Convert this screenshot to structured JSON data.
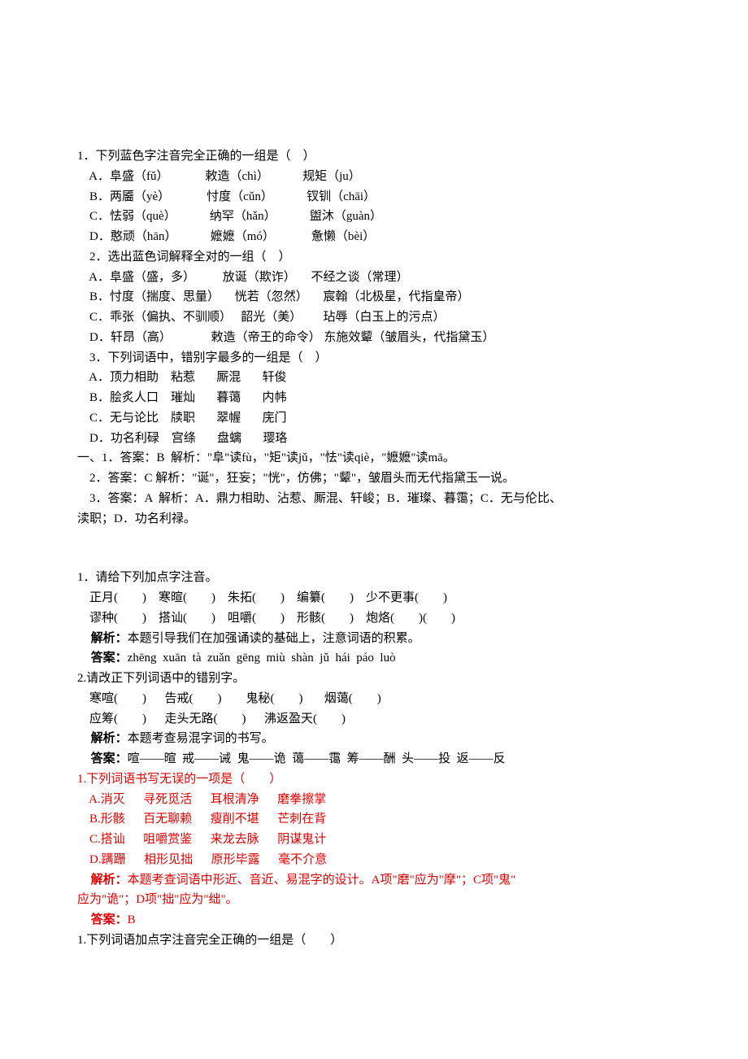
{
  "block1": {
    "q1": {
      "stem": "1．下列蓝色字注音完全正确的一组是（　）",
      "A": "    A．阜盛（fǔ）            敕造（chì）           规矩（ju）",
      "B": "    B．两靥（yè）            忖度（cǔn）           钗钏（chāi）",
      "C": "    C．怯弱（què）           纳罕（hǎn）           盥沐（guàn）",
      "D": "    D．憨顽（hān）           嬷嬷（mó）            惫懒（bèi）"
    },
    "q2": {
      "stem": "    2．选出蓝色词解释全对的一组（　）",
      "A": "    A．阜盛（盛，多）         放诞（欺诈）     不经之谈（常理）",
      "B": "    B．忖度（揣度、思量）     恍若（忽然）     宸翰（北极星，代指皇帝）",
      "C": "    C．乖张（偏执、不驯顺）   韶光（美）       玷辱（白玉上的污点）",
      "D": "    D．轩昂（高）             敕造（帝王的命令） 东施效颦（皱眉头，代指黛玉）"
    },
    "q3": {
      "stem": "    3．下列词语中，错别字最多的一组是（　）",
      "A": "    A．顶力相助    粘惹       厮混       轩俊",
      "B": "    B．脍炙人口    璀灿       暮蔼       内帏",
      "C": "    C．无与论比    牍职       翠幄       庑门",
      "D": "    D．功名利碌    宫绦       盘螭       璎珞"
    },
    "answers": {
      "a1": "一、1．答案：B  解析：\"阜\"读fù，\"矩\"读jǔ，\"怯\"读qiè，\"嬷嬷\"读mā。",
      "a2": "    2．答案：C 解析：\"诞\"，狂妄；\"恍\"，仿佛；\"颦\"，皱眉头而无代指黛玉一说。",
      "a3_l1": "    3．答案：A  解析：A．鼎力相助、沾惹、厮混、轩峻；B．璀璨、暮霭；C．无与伦比、",
      "a3_l2": "渎职；D．功名利禄。"
    }
  },
  "block2": {
    "q1": {
      "stem": "1．请给下列加点字注音。",
      "l1": "    正月(　　)    寒暄(　　)    朱拓(　　)    编纂(　　)    少不更事(　　)",
      "l2": "    谬种(　　)    搭讪(　　)    咀嚼(　　)    形骸(　　)    炮烙(　　)(　　)",
      "jx_label": "    解析：",
      "jx_text": "本题引导我们在加强诵读的基础上，注意词语的积累。",
      "ans_label": "    答案：",
      "ans_text": "zhēng  xuān  tà  zuǎn  gēng  miù  shàn  jǔ  hái  páo  luò"
    },
    "q2": {
      "stem": "2.请改正下列词语中的错别字。",
      "l1": "    寒喧(　　)      告戒(　　)        鬼秘(　　)       烟蔼(　　)",
      "l2": "    应筹(　　)      走头无路(　　)      沸返盈天(　　)",
      "jx_label": "    解析：",
      "jx_text": "本题考查易混字词的书写。",
      "ans_label": "    答案：",
      "ans_text": "喧——暄  戒——诫  鬼——诡  蔼——霭  筹——酬  头——投  返——反"
    }
  },
  "block3": {
    "q1": {
      "stem": "1.下列词语书写无误的一项是（　　）",
      "A": "    A.消灭      寻死觅活      耳根清净      磨拳擦掌",
      "B": "    B.形骸      百无聊赖      瘦削不堪      芒刺在背",
      "C": "    C.搭讪      咀嚼赏鉴      来龙去脉      阴谋鬼计",
      "D": "    D.蹒跚      相形见拙      原形毕露      毫不介意",
      "jx_label": "    解析：",
      "jx_l1": "本题考查词语中形近、音近、易混字的设计。A项\"磨\"应为\"摩\"；C项\"鬼\"",
      "jx_l2": "应为\"诡\"；D项\"拙\"应为\"绌\"。",
      "ans_label": "    答案：",
      "ans_text": "B"
    },
    "q2": {
      "stem": "1.下列词语加点字注音完全正确的一组是（　　）"
    }
  }
}
